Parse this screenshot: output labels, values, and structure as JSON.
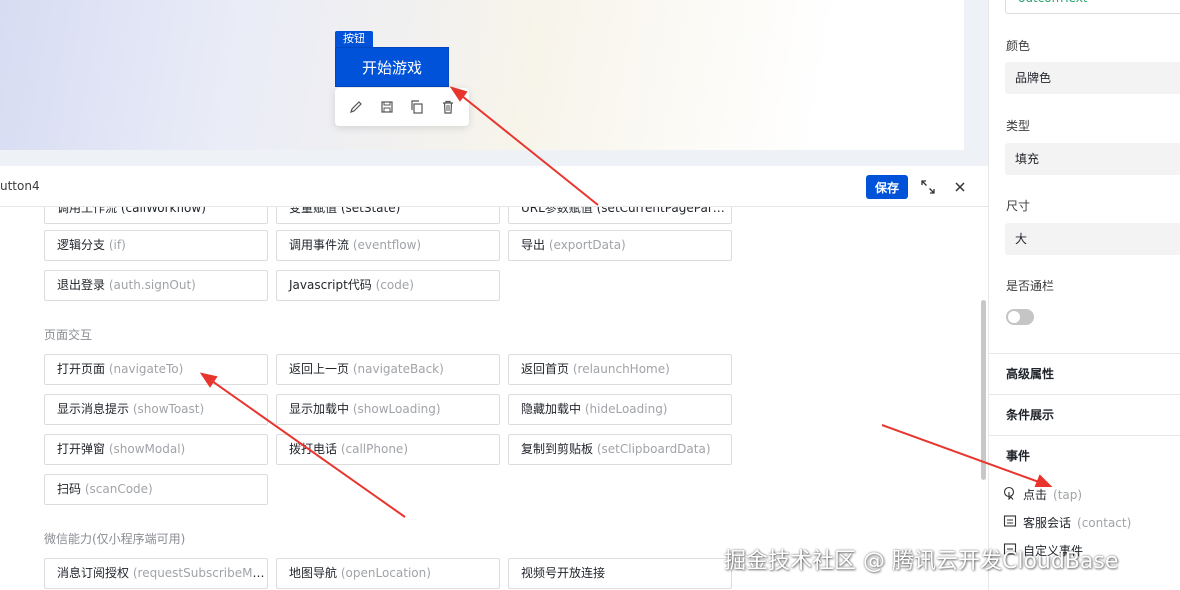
{
  "canvas": {
    "widget_tag": "按钮",
    "start_button_label": "开始游戏"
  },
  "editor": {
    "title": "utton4",
    "save_label": "保存"
  },
  "actions": {
    "row0": [
      "调用工作流 (callWorkflow)",
      "变量赋值 (setState)",
      "URL参数赋值 (setCurrentPageParams)"
    ],
    "row1": [
      {
        "zh": "逻辑分支",
        "en": "(if)"
      },
      {
        "zh": "调用事件流",
        "en": "(eventflow)"
      },
      {
        "zh": "导出",
        "en": "(exportData)"
      }
    ],
    "row2": [
      {
        "zh": "退出登录",
        "en": "(auth.signOut)"
      },
      {
        "zh": "Javascript代码",
        "en": "(code)"
      }
    ],
    "section_page": "页面交互",
    "row3": [
      {
        "zh": "打开页面",
        "en": "(navigateTo)"
      },
      {
        "zh": "返回上一页",
        "en": "(navigateBack)"
      },
      {
        "zh": "返回首页",
        "en": "(relaunchHome)"
      }
    ],
    "row4": [
      {
        "zh": "显示消息提示",
        "en": "(showToast)"
      },
      {
        "zh": "显示加载中",
        "en": "(showLoading)"
      },
      {
        "zh": "隐藏加载中",
        "en": "(hideLoading)"
      }
    ],
    "row5": [
      {
        "zh": "打开弹窗",
        "en": "(showModal)"
      },
      {
        "zh": "拨打电话",
        "en": "(callPhone)"
      },
      {
        "zh": "复制到剪贴板",
        "en": "(setClipboardData)"
      }
    ],
    "row6": [
      {
        "zh": "扫码",
        "en": "(scanCode)"
      }
    ],
    "section_wechat": "微信能力(仅小程序端可用)",
    "row7": [
      {
        "zh": "消息订阅授权",
        "en": "(requestSubscribeMe..."
      },
      {
        "zh": "地图导航",
        "en": "(openLocation)"
      },
      {
        "zh": "视频号开放连接",
        "en": ""
      }
    ]
  },
  "panel": {
    "top_input": "outcomText",
    "color_label": "颜色",
    "color_value": "品牌色",
    "type_label": "类型",
    "type_value": "填充",
    "size_label": "尺寸",
    "size_value": "大",
    "banner_label": "是否通栏",
    "advanced": "高级属性",
    "conditional": "条件展示",
    "events": "事件",
    "event_tap_zh": "点击",
    "event_tap_en": "(tap)",
    "event_contact_zh": "客服会话",
    "event_contact_en": "(contact)",
    "event_custom_zh": "自定义事件"
  },
  "watermark": "掘金技术社区 @ 腾讯云开发CloudBase",
  "colors": {
    "brand": "#0052d9",
    "arrow": "#e8352e"
  }
}
